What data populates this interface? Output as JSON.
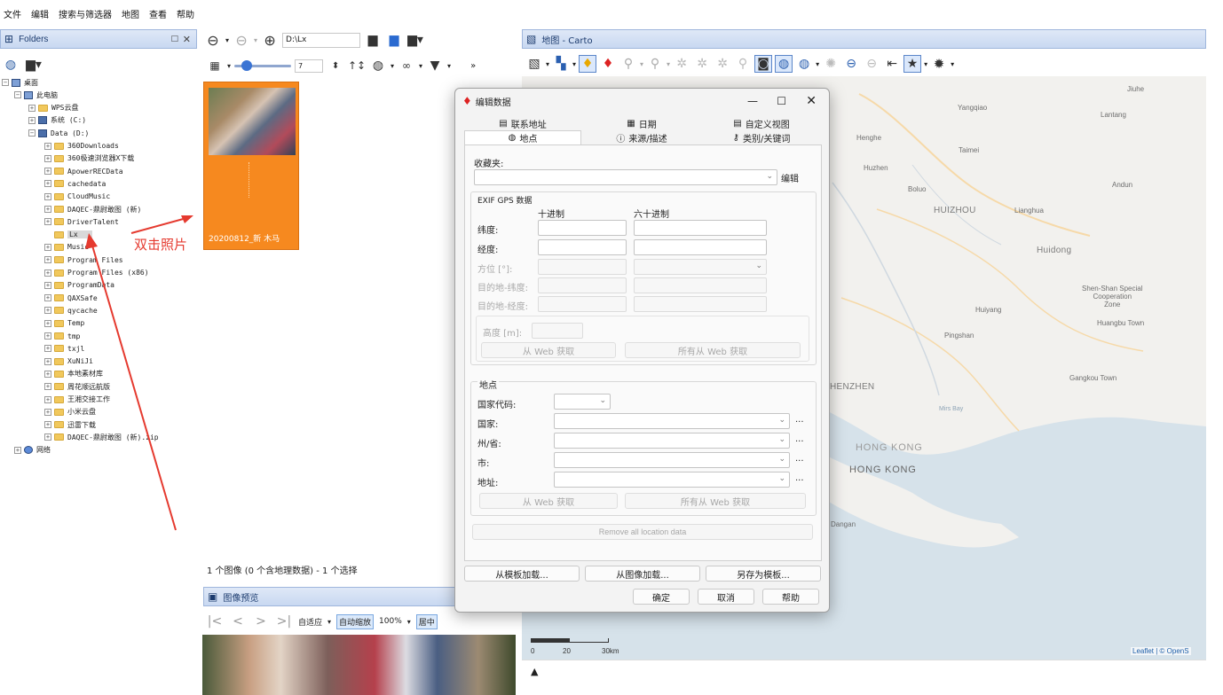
{
  "menu": [
    "文件",
    "编辑",
    "搜索与筛选器",
    "地图",
    "查看",
    "帮助"
  ],
  "folders_panel": {
    "title": "Folders",
    "tree": [
      {
        "label": "桌面",
        "level": 0,
        "type": "desktop"
      },
      {
        "label": "此电脑",
        "level": 1,
        "type": "pc"
      },
      {
        "label": "WPS云盘",
        "level": 2,
        "type": "folder"
      },
      {
        "label": "系统 (C:)",
        "level": 2,
        "type": "drive"
      },
      {
        "label": "Data (D:)",
        "level": 2,
        "type": "drive"
      },
      {
        "label": "360Downloads",
        "level": 3,
        "type": "folder"
      },
      {
        "label": "360极速浏览器X下载",
        "level": 3,
        "type": "folder"
      },
      {
        "label": "ApowerRECData",
        "level": 3,
        "type": "folder"
      },
      {
        "label": "cachedata",
        "level": 3,
        "type": "folder"
      },
      {
        "label": "CloudMusic",
        "level": 3,
        "type": "folder"
      },
      {
        "label": "DAQEC-鼎尉敢图 (新)",
        "level": 3,
        "type": "folder"
      },
      {
        "label": "DriverTalent",
        "level": 3,
        "type": "folder"
      },
      {
        "label": "Lx",
        "level": 3,
        "type": "folder",
        "selected": true
      },
      {
        "label": "Music",
        "level": 3,
        "type": "folder"
      },
      {
        "label": "Program Files",
        "level": 3,
        "type": "folder"
      },
      {
        "label": "Program Files (x86)",
        "level": 3,
        "type": "folder"
      },
      {
        "label": "ProgramData",
        "level": 3,
        "type": "folder"
      },
      {
        "label": "QAXSafe",
        "level": 3,
        "type": "folder"
      },
      {
        "label": "qycache",
        "level": 3,
        "type": "folder"
      },
      {
        "label": "Temp",
        "level": 3,
        "type": "folder"
      },
      {
        "label": "tmp",
        "level": 3,
        "type": "folder"
      },
      {
        "label": "txjl",
        "level": 3,
        "type": "folder"
      },
      {
        "label": "XuNiJi",
        "level": 3,
        "type": "folder"
      },
      {
        "label": "本地素材库",
        "level": 3,
        "type": "folder"
      },
      {
        "label": "周花顺远航版",
        "level": 3,
        "type": "folder"
      },
      {
        "label": "王湘交接工作",
        "level": 3,
        "type": "folder"
      },
      {
        "label": "小米云盘",
        "level": 3,
        "type": "folder"
      },
      {
        "label": "迅雷下载",
        "level": 3,
        "type": "folder"
      },
      {
        "label": "DAQEC-鼎尉敢图 (新).zip",
        "level": 3,
        "type": "folder"
      },
      {
        "label": "网络",
        "level": 1,
        "type": "network"
      }
    ]
  },
  "browser": {
    "path": "D:\\Lx",
    "slider_value": "7",
    "thumbnail_caption": "20200812_新 木马",
    "status": "1 个图像 (0 个含地理数据) - 1 个选择"
  },
  "annotation": {
    "text": "双击照片",
    "color": "#e53a2f"
  },
  "preview": {
    "title": "图像预览",
    "fit_label": "自适应",
    "auto_zoom_label": "自动缩放",
    "zoom_label": "100%",
    "center_label": "居中"
  },
  "map_panel": {
    "title": "地图 - Carto",
    "scale_labels": [
      "0",
      "20",
      "30km"
    ],
    "attribution": "Leaflet | © OpenS",
    "labels": [
      {
        "text": "Jiuhe",
        "cls": ""
      },
      {
        "text": "Yangqiao",
        "cls": ""
      },
      {
        "text": "Lantang",
        "cls": ""
      },
      {
        "text": "Henghe",
        "cls": ""
      },
      {
        "text": "Taimei",
        "cls": ""
      },
      {
        "text": "Huzhen",
        "cls": ""
      },
      {
        "text": "Boluo",
        "cls": ""
      },
      {
        "text": "Andun",
        "cls": ""
      },
      {
        "text": "HUIZHOU",
        "cls": "big"
      },
      {
        "text": "Lianghua",
        "cls": ""
      },
      {
        "text": "Huidong",
        "cls": "big"
      },
      {
        "text": "Shen-Shan Special\nCooperation\nZone",
        "cls": ""
      },
      {
        "text": "Huiyang",
        "cls": ""
      },
      {
        "text": "Huangbu Town",
        "cls": ""
      },
      {
        "text": "Pingshan",
        "cls": ""
      },
      {
        "text": "HENZHEN",
        "cls": "big"
      },
      {
        "text": "Gangkou Town",
        "cls": ""
      },
      {
        "text": "Mirs Bay",
        "cls": ""
      },
      {
        "text": "HONG KONG",
        "cls": "hk"
      },
      {
        "text": "HONG KONG",
        "cls": "hk"
      },
      {
        "text": "Dangan",
        "cls": ""
      }
    ]
  },
  "dialog": {
    "title": "编辑数据",
    "tabs_row1": [
      "联系地址",
      "日期",
      "自定义视图"
    ],
    "tabs_row2": [
      "地点",
      "来源/描述",
      "类别/关键词"
    ],
    "active_tab": "地点",
    "favorites_label": "收藏夹:",
    "edit_button": "编辑",
    "exif_group": "EXIF GPS 数据",
    "col_decimal": "十进制",
    "col_sexagesimal": "六十进制",
    "latitude_label": "纬度:",
    "longitude_label": "经度:",
    "bearing_label": "方位 [°]:",
    "dest_lat_label": "目的地-纬度:",
    "dest_lon_label": "目的地-经度:",
    "altitude_label": "高度 [m]:",
    "from_web": "从 Web 获取",
    "all_from_web": "所有从 Web 获取",
    "location_group": "地点",
    "country_code_label": "国家代码:",
    "country_label": "国家:",
    "state_label": "州/省:",
    "city_label": "市:",
    "address_label": "地址:",
    "ellipsis": "...",
    "remove_location": "Remove all location data",
    "load_template": "从模板加载...",
    "load_image": "从图像加载...",
    "save_template": "另存为模板...",
    "ok": "确定",
    "cancel": "取消",
    "help": "帮助"
  }
}
